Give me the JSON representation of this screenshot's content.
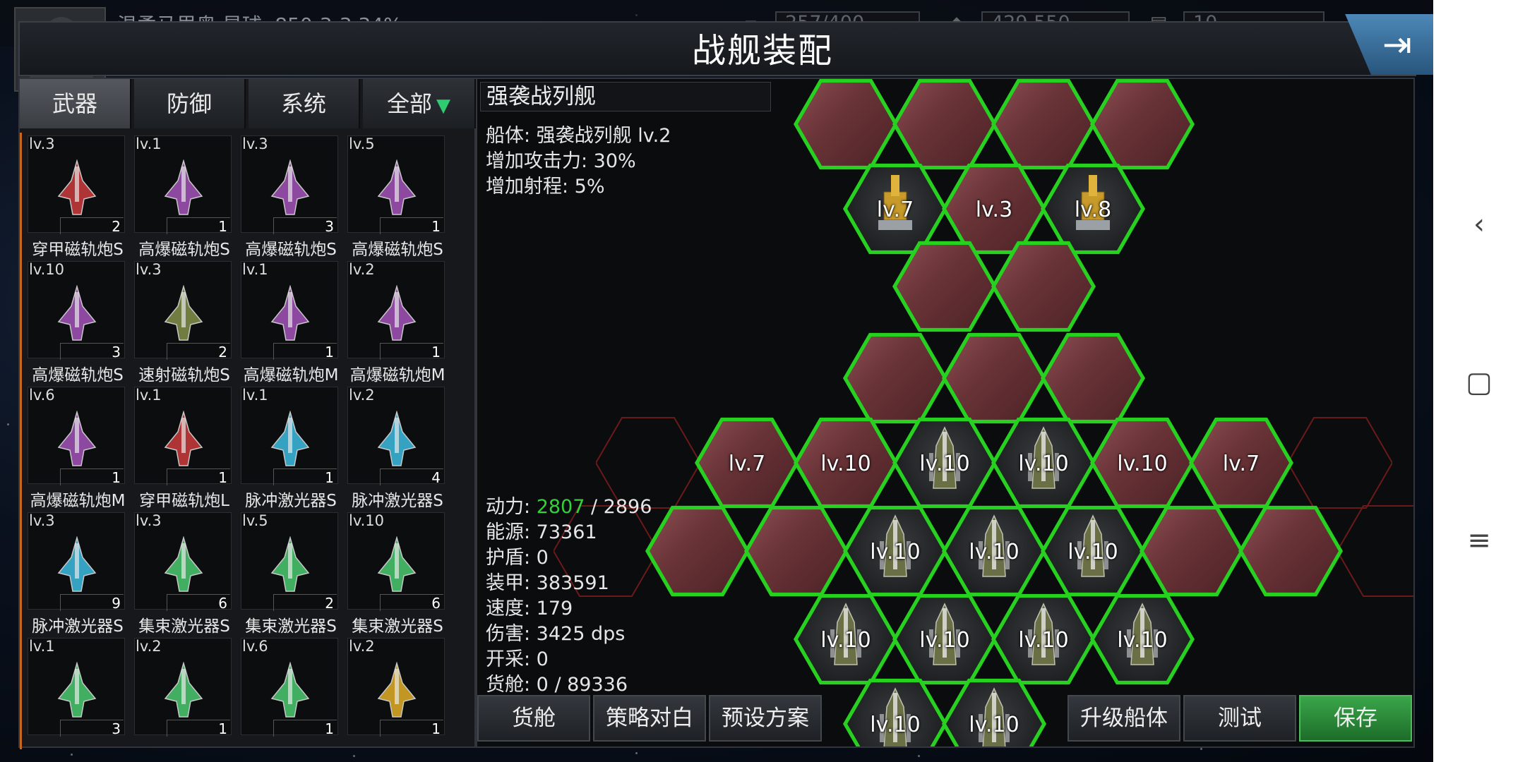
{
  "top": {
    "player_text": "温柔马里奥   星球: 850-3-3  34%",
    "cargo_value": "257/400",
    "money_value": "429,550",
    "item_value": "10"
  },
  "title": "战舰装配",
  "tabs": [
    "武器",
    "防御",
    "系统",
    "全部"
  ],
  "weapons": [
    {
      "lv": "lv.3",
      "qty": "2",
      "name": "穿甲磁轨炮S",
      "color": "#c0393b"
    },
    {
      "lv": "lv.1",
      "qty": "1",
      "name": "高爆磁轨炮S",
      "color": "#9b4fb0"
    },
    {
      "lv": "lv.3",
      "qty": "3",
      "name": "高爆磁轨炮S",
      "color": "#9b4fb0"
    },
    {
      "lv": "lv.5",
      "qty": "1",
      "name": "高爆磁轨炮S",
      "color": "#9b4fb0"
    },
    {
      "lv": "lv.10",
      "qty": "3",
      "name": "高爆磁轨炮S",
      "color": "#9b4fb0"
    },
    {
      "lv": "lv.3",
      "qty": "2",
      "name": "速射磁轨炮S",
      "color": "#7d8a46"
    },
    {
      "lv": "lv.1",
      "qty": "1",
      "name": "高爆磁轨炮M",
      "color": "#9b4fb0"
    },
    {
      "lv": "lv.2",
      "qty": "1",
      "name": "高爆磁轨炮M",
      "color": "#9b4fb0"
    },
    {
      "lv": "lv.6",
      "qty": "1",
      "name": "高爆磁轨炮M",
      "color": "#9b4fb0"
    },
    {
      "lv": "lv.1",
      "qty": "1",
      "name": "穿甲磁轨炮L",
      "color": "#c0393b"
    },
    {
      "lv": "lv.1",
      "qty": "1",
      "name": "脉冲激光器S",
      "color": "#3ab3d6"
    },
    {
      "lv": "lv.2",
      "qty": "4",
      "name": "脉冲激光器S",
      "color": "#3ab3d6"
    },
    {
      "lv": "lv.3",
      "qty": "9",
      "name": "脉冲激光器S",
      "color": "#3ab3d6"
    },
    {
      "lv": "lv.3",
      "qty": "6",
      "name": "集束激光器S",
      "color": "#47c06a"
    },
    {
      "lv": "lv.5",
      "qty": "2",
      "name": "集束激光器S",
      "color": "#47c06a"
    },
    {
      "lv": "lv.10",
      "qty": "6",
      "name": "集束激光器S",
      "color": "#47c06a"
    },
    {
      "lv": "lv.1",
      "qty": "3",
      "name": "",
      "color": "#47c06a"
    },
    {
      "lv": "lv.2",
      "qty": "1",
      "name": "",
      "color": "#47c06a"
    },
    {
      "lv": "lv.6",
      "qty": "1",
      "name": "",
      "color": "#47c06a"
    },
    {
      "lv": "lv.2",
      "qty": "1",
      "name": "",
      "color": "#d6a526"
    }
  ],
  "ship": {
    "name": "强袭战列舰",
    "hull": "船体: 强袭战列舰 lv.2",
    "attack_bonus": "增加攻击力: 30%",
    "range_bonus": "增加射程: 5%"
  },
  "stats": {
    "power_label": "动力: ",
    "power_used": "2807",
    "power_total": " / 2896",
    "energy": "能源: 73361",
    "shield": "护盾: 0",
    "armor": "装甲: 383591",
    "speed": "速度: 179",
    "damage": "伤害: 3425 dps",
    "mining": "开采: 0",
    "cargo": "货舱: 0 / 89336"
  },
  "hexes": [
    {
      "lv": "",
      "kind": "armor"
    },
    {
      "lv": "",
      "kind": "armor"
    },
    {
      "lv": "",
      "kind": "armor"
    },
    {
      "lv": "",
      "kind": "armor"
    },
    {
      "lv": "lv.7",
      "kind": "turret"
    },
    {
      "lv": "lv.3",
      "kind": "armor"
    },
    {
      "lv": "lv.8",
      "kind": "turret"
    },
    {
      "lv": "",
      "kind": "armor"
    },
    {
      "lv": "",
      "kind": "armor"
    },
    {
      "lv": "",
      "kind": "armor"
    },
    {
      "lv": "",
      "kind": "armor"
    },
    {
      "lv": "",
      "kind": "armor"
    },
    {
      "lv": "lv.7",
      "kind": "armor"
    },
    {
      "lv": "lv.10",
      "kind": "armor"
    },
    {
      "lv": "lv.10",
      "kind": "engine"
    },
    {
      "lv": "lv.10",
      "kind": "engine"
    },
    {
      "lv": "lv.10",
      "kind": "armor"
    },
    {
      "lv": "lv.7",
      "kind": "armor"
    },
    {
      "lv": "",
      "kind": "armor"
    },
    {
      "lv": "",
      "kind": "armor"
    },
    {
      "lv": "lv.10",
      "kind": "engine"
    },
    {
      "lv": "lv.10",
      "kind": "engine"
    },
    {
      "lv": "lv.10",
      "kind": "engine"
    },
    {
      "lv": "",
      "kind": "armor"
    },
    {
      "lv": "",
      "kind": "armor"
    },
    {
      "lv": "lv.10",
      "kind": "engine"
    },
    {
      "lv": "lv.10",
      "kind": "engine"
    },
    {
      "lv": "lv.10",
      "kind": "engine"
    },
    {
      "lv": "lv.10",
      "kind": "engine"
    },
    {
      "lv": "lv.10",
      "kind": "engine"
    },
    {
      "lv": "lv.10",
      "kind": "engine"
    }
  ],
  "buttons": {
    "cargo": "货舱",
    "strategy": "策略对白",
    "preset": "预设方案",
    "upgrade": "升级船体",
    "test": "测试",
    "save": "保存"
  },
  "colors": {
    "accent_green": "#27d11f",
    "power_used": "#33d13a",
    "save_green": "#2e8c3a",
    "exit_blue": "#3b74a4"
  }
}
